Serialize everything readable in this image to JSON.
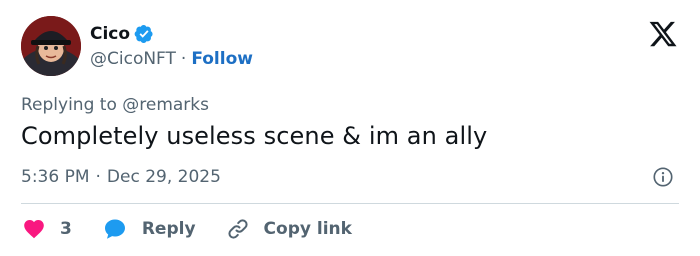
{
  "user": {
    "display_name": "Cico",
    "handle": "@CicoNFT",
    "separator": "·",
    "follow_label": "Follow"
  },
  "tweet": {
    "replying_prefix": "Replying to",
    "replying_handle": "@remarks",
    "text": "Completely useless scene & im an ally",
    "time": "5:36 PM",
    "separator": "·",
    "date": "Dec 29, 2025"
  },
  "actions": {
    "like_count": "3",
    "reply_label": "Reply",
    "copy_label": "Copy link"
  },
  "colors": {
    "like": "#f91880",
    "reply": "#1d9bf0",
    "follow": "#1d6fc4",
    "verified": "#1d9bf0",
    "secondary_text": "#536471"
  },
  "icons": [
    "verified-badge-icon",
    "x-logo-icon",
    "info-icon",
    "heart-icon",
    "reply-bubble-icon",
    "link-icon"
  ]
}
